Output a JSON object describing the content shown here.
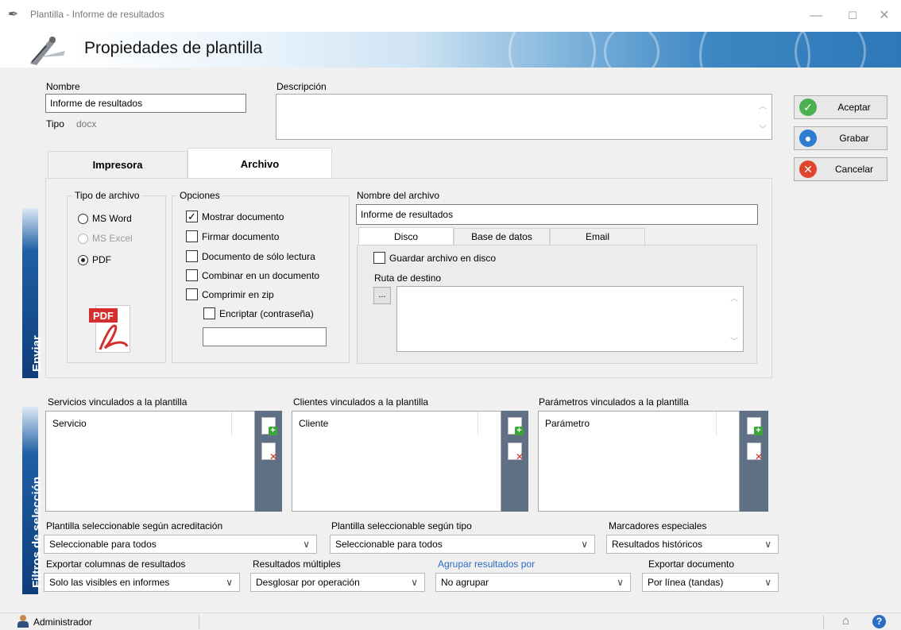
{
  "window": {
    "title": "Plantilla - Informe de resultados",
    "minimize": "—",
    "maximize": "☐",
    "close": "✕"
  },
  "header": {
    "heading": "Propiedades de plantilla"
  },
  "form": {
    "nombre_label": "Nombre",
    "nombre_value": "Informe de resultados",
    "tipo_label": "Tipo",
    "tipo_value": "docx",
    "descripcion_label": "Descripción",
    "descripcion_value": ""
  },
  "actions": {
    "accept": "Aceptar",
    "save": "Grabar",
    "cancel": "Cancelar"
  },
  "tabs": {
    "printer": "Impresora",
    "file": "Archivo"
  },
  "file_tab": {
    "file_type_label": "Tipo de archivo",
    "types": [
      "MS Word",
      "MS Excel",
      "PDF"
    ],
    "selected_type": "PDF",
    "pdf_logo_text": "PDF",
    "options_label": "Opciones",
    "options": [
      {
        "label": "Mostrar documento",
        "checked": true
      },
      {
        "label": "Firmar documento",
        "checked": false
      },
      {
        "label": "Documento de sólo lectura",
        "checked": false
      },
      {
        "label": "Combinar en un documento",
        "checked": false
      },
      {
        "label": "Comprimir en zip",
        "checked": false
      }
    ],
    "encrypt_label": "Encriptar (contraseña)",
    "encrypt_checked": false,
    "password_value": "",
    "filename_label": "Nombre del archivo",
    "filename_value": "Informe de resultados",
    "subtabs": [
      "Disco",
      "Base de datos",
      "Email"
    ],
    "save_to_disk_label": "Guardar archivo en disco",
    "destination_label": "Ruta de destino",
    "browse_label": "...",
    "destination_value": ""
  },
  "side_labels": {
    "send": "Enviar",
    "filters": "Filtros de selección"
  },
  "lists": {
    "services_label": "Servicios vinculados a la plantilla",
    "services_column": "Servicio",
    "clients_label": "Clientes vinculados a la plantilla",
    "clients_column": "Cliente",
    "params_label": "Parámetros vinculados a la plantilla",
    "params_column": "Parámetro"
  },
  "selectors": {
    "accreditation_label": "Plantilla seleccionable según acreditación",
    "accreditation_value": "Seleccionable para todos",
    "type_label": "Plantilla seleccionable según tipo",
    "type_value": "Seleccionable para todos",
    "markers_label": "Marcadores especiales",
    "markers_value": "Resultados históricos",
    "export_columns_label": "Exportar columnas de resultados",
    "export_columns_value": "Solo las visibles en informes",
    "multiple_results_label": "Resultados múltiples",
    "multiple_results_value": "Desglosar por operación",
    "group_by_label": "Agrupar resultados por",
    "group_by_value": "No agrupar",
    "export_doc_label": "Exportar documento",
    "export_doc_value": "Por línea (tandas)"
  },
  "status": {
    "user": "Administrador"
  },
  "colors": {
    "accent_link": "#2b6cc4",
    "side_banner": "#1f5fa3",
    "toolstrip": "#5f6f84"
  }
}
